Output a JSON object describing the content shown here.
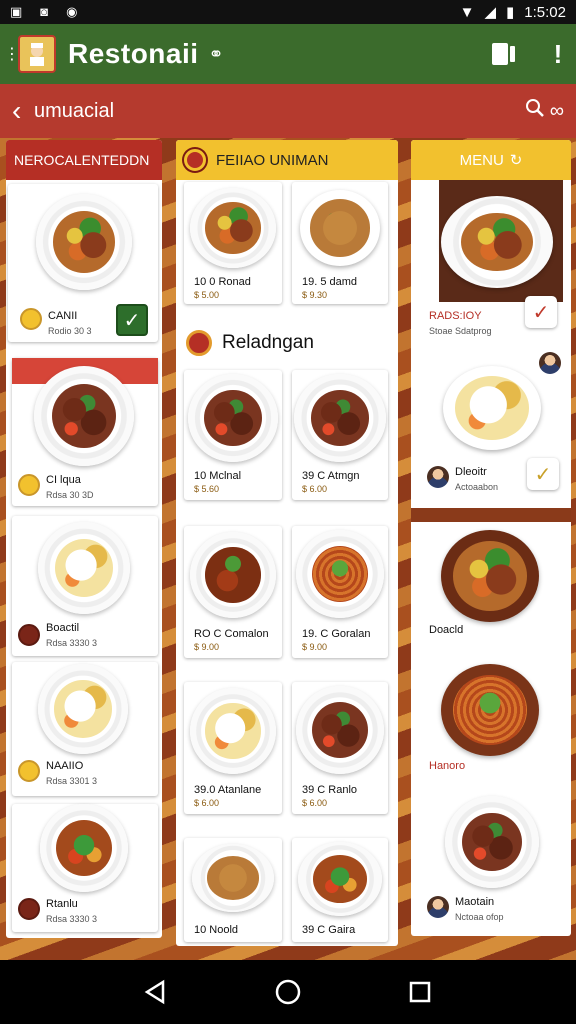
{
  "status_bar": {
    "time": "1:5:02",
    "left_icons": [
      "image-icon",
      "screenshot-icon",
      "sync-icon"
    ],
    "right_icons": [
      "wifi-icon",
      "signal-icon",
      "battery-icon"
    ]
  },
  "app_bar": {
    "title": "Restonaii",
    "icons": [
      "menu-icon",
      "logo-icon",
      "link-icon",
      "tablet-icon",
      "more-icon"
    ]
  },
  "sub_bar": {
    "title": "umuacial",
    "icons": [
      "back-icon",
      "search-icon",
      "infinity-icon"
    ]
  },
  "colors": {
    "app_bar": "#3b6b2c",
    "sub_bar": "#b53a2e",
    "accent_yellow": "#f2c12e",
    "accent_red": "#b52f25"
  },
  "column1": {
    "header": "NEROCALENTEDDN",
    "items": [
      {
        "title": "CANII",
        "sub": "Rodio 30 3",
        "checked": true
      },
      {
        "title": "CI lqua",
        "sub": "Rdsa 30 3D"
      },
      {
        "title": "Boactil",
        "sub": "Rdsa 3330 3"
      },
      {
        "title": "NAAIIO",
        "sub": "Rdsa 3301 3"
      },
      {
        "title": "Rtanlu",
        "sub": "Rdsa 3330 3"
      }
    ]
  },
  "column2": {
    "header": "FEIIAO UNIMAN",
    "section_title": "Reladngan",
    "items": [
      {
        "title": "10 0 Ronad",
        "price": "$ 5.00"
      },
      {
        "title": "19. 5 damd",
        "price": "$ 9.30"
      },
      {
        "title": "10 Mclnal",
        "price": "$ 5.60"
      },
      {
        "title": "39 C Atmgn",
        "price": "$ 6.00"
      },
      {
        "title": "RO C Comalon",
        "price": "$ 9.00"
      },
      {
        "title": "19. C Goralan",
        "price": "$ 9.00"
      },
      {
        "title": "39.0 Atanlane",
        "price": "$ 6.00"
      },
      {
        "title": "39 C Ranlo",
        "price": "$ 6.00"
      },
      {
        "title": "10 Noold",
        "price": ""
      },
      {
        "title": "39 C Gaira",
        "price": ""
      }
    ]
  },
  "column3": {
    "header": "MENU",
    "items": [
      {
        "title": "RADS:IOY",
        "sub": "Stoae Sdatprog",
        "checked": true
      },
      {
        "title": "Dleoitr",
        "sub": "Actoaabon",
        "checked": true
      },
      {
        "title": "Doacld"
      },
      {
        "title": "Hanoro"
      },
      {
        "title": "Maotain",
        "sub": "Nctoaa ofop"
      }
    ]
  },
  "nav_bar": {
    "icons": [
      "back-triangle-icon",
      "home-circle-icon",
      "recents-square-icon"
    ]
  }
}
